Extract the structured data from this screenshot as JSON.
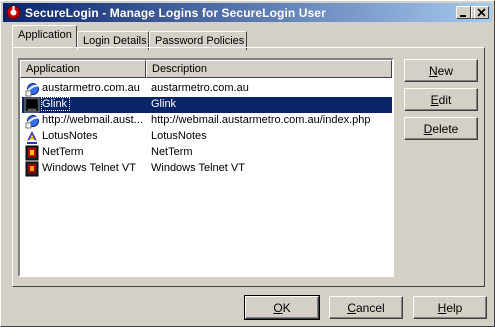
{
  "window": {
    "title": "SecureLogin - Manage Logins for SecureLogin User"
  },
  "tabs": [
    {
      "label": "Application"
    },
    {
      "label": "Login Details"
    },
    {
      "label": "Password Policies"
    }
  ],
  "list": {
    "columns": [
      "Application",
      "Description"
    ],
    "rows": [
      {
        "app": "austarmetro.com.au",
        "desc": "austarmetro.com.au",
        "icon": "web-icon"
      },
      {
        "app": "Glink",
        "desc": "Glink",
        "icon": "terminal-icon",
        "selected": true
      },
      {
        "app": "http://webmail.aust...",
        "desc": "http://webmail.austarmetro.com.au/index.php",
        "icon": "web-icon"
      },
      {
        "app": "LotusNotes",
        "desc": "LotusNotes",
        "icon": "lotus-notes-icon"
      },
      {
        "app": "NetTerm",
        "desc": "NetTerm",
        "icon": "netterm-icon"
      },
      {
        "app": "Windows Telnet VT",
        "desc": "Windows Telnet VT",
        "icon": "telnet-icon"
      }
    ]
  },
  "side_buttons": {
    "new": {
      "pre": "",
      "u": "N",
      "post": "ew"
    },
    "edit": {
      "pre": "",
      "u": "E",
      "post": "dit"
    },
    "delete": {
      "pre": "",
      "u": "D",
      "post": "elete"
    }
  },
  "bottom_buttons": {
    "ok": {
      "pre": "",
      "u": "O",
      "post": "K"
    },
    "cancel": {
      "pre": "",
      "u": "C",
      "post": "ancel"
    },
    "help": {
      "pre": "",
      "u": "H",
      "post": "elp"
    }
  },
  "colors": {
    "selection": "#0a246a",
    "face": "#d4d0c8"
  }
}
